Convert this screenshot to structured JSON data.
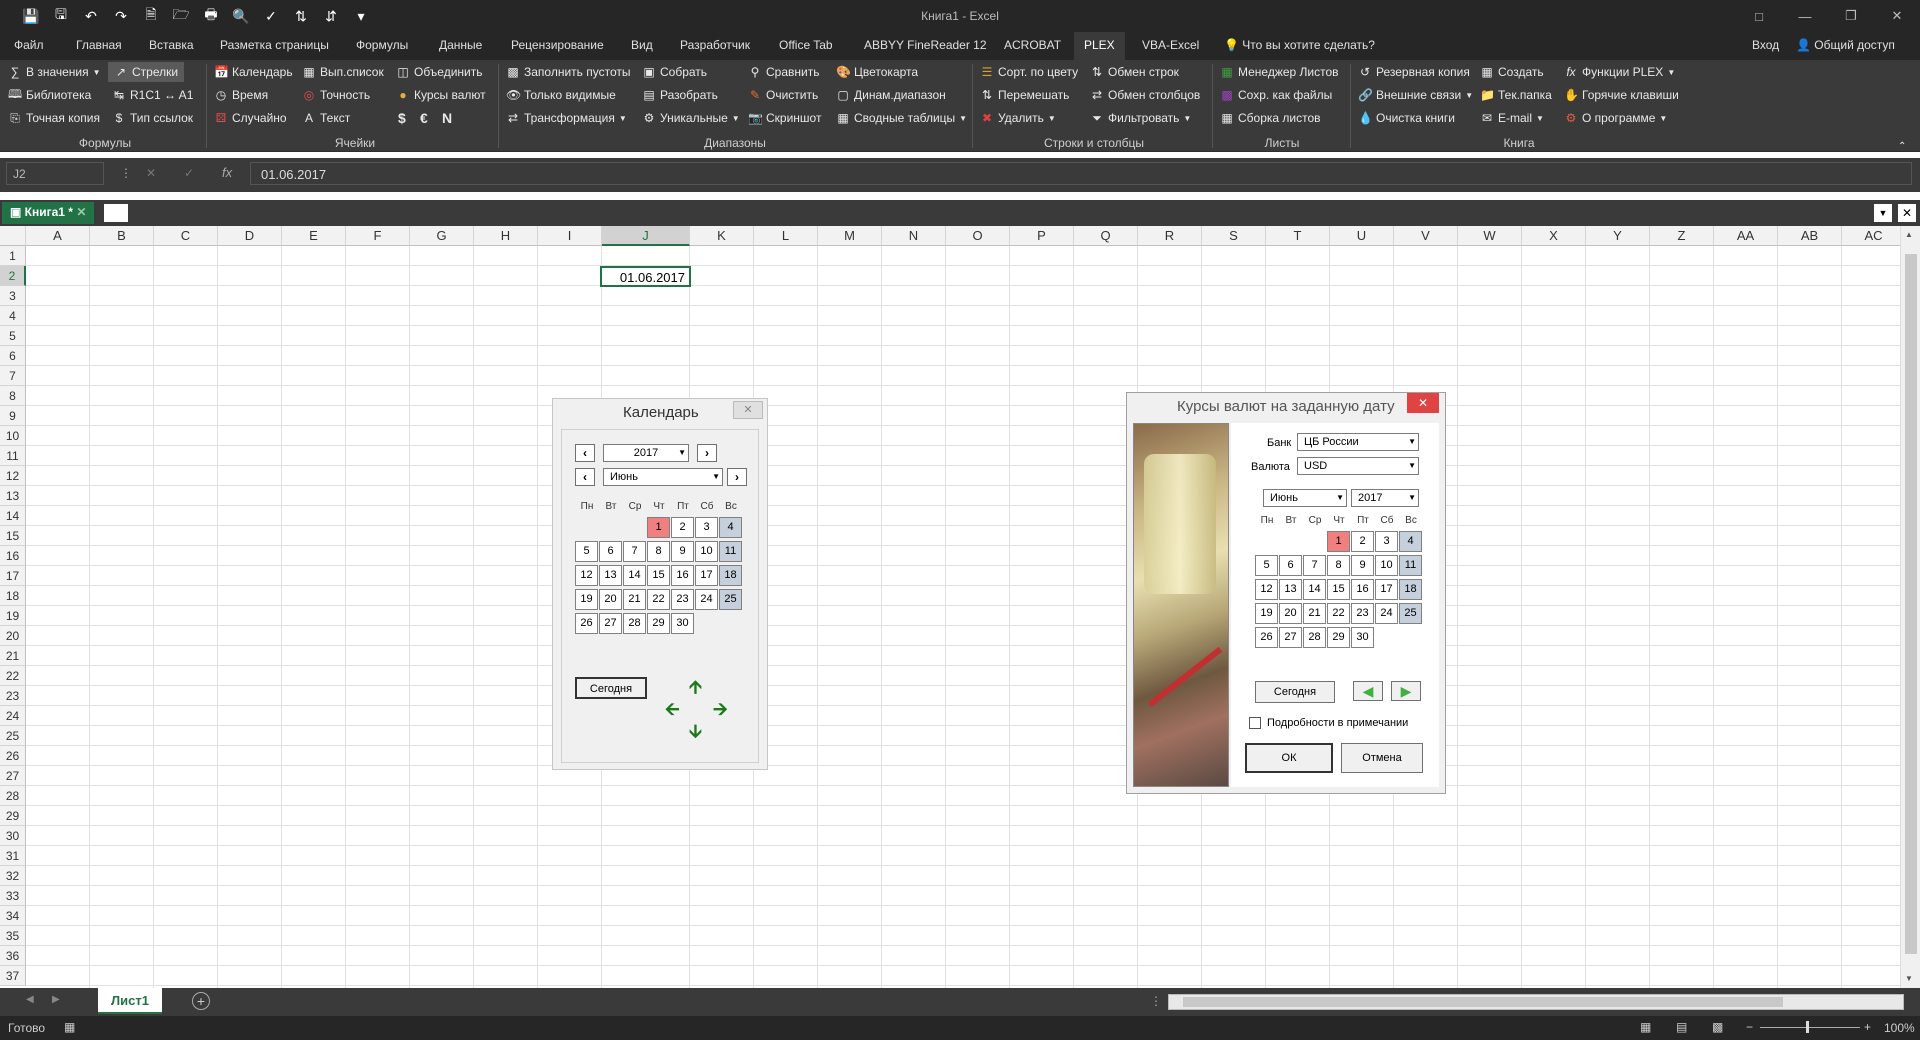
{
  "window": {
    "title": "Книга1 - Excel"
  },
  "ribbon_tabs": [
    "Файл",
    "Главная",
    "Вставка",
    "Разметка страницы",
    "Формулы",
    "Данные",
    "Рецензирование",
    "Вид",
    "Разработчик",
    "Office Tab",
    "ABBYY FineReader 12",
    "ACROBAT",
    "PLEX",
    "VBA-Excel",
    "Что вы хотите сделать?"
  ],
  "account": {
    "signin": "Вход",
    "share": "Общий доступ"
  },
  "ribbon": {
    "formulas": {
      "label": "Формулы",
      "items": [
        "В значения",
        "Библиотека",
        "Точная копия",
        "Стрелки",
        "R1C1 ↔ A1",
        "Тип ссылок"
      ]
    },
    "cells": {
      "label": "Ячейки",
      "items": [
        "Календарь",
        "Время",
        "Случайно",
        "Вып.список",
        "Точность",
        "Текст",
        "Объединить",
        "Курсы валют",
        "$",
        "€",
        "N"
      ]
    },
    "ranges": {
      "label": "Диапазоны",
      "items": [
        "Заполнить пустоты",
        "Только видимые",
        "Трансформация",
        "Собрать",
        "Разобрать",
        "Уникальные",
        "Сравнить",
        "Очистить",
        "Скриншот",
        "Цветокарта",
        "Динам.диапазон",
        "Сводные таблицы"
      ]
    },
    "rowscols": {
      "label": "Строки и столбцы",
      "items": [
        "Сорт. по цвету",
        "Перемешать",
        "Удалить",
        "Обмен строк",
        "Обмен столбцов",
        "Фильтровать"
      ]
    },
    "sheets": {
      "label": "Листы",
      "items": [
        "Менеджер Листов",
        "Сохр. как файлы",
        "Сборка листов"
      ]
    },
    "book": {
      "label": "Книга",
      "items": [
        "Резервная копия",
        "Внешние связи",
        "Очистка книги",
        "Создать",
        "Тек.папка",
        "E-mail",
        "Функции PLEX",
        "Горячие клавиши",
        "О программе"
      ]
    }
  },
  "formula_bar": {
    "name_box": "J2",
    "fx": "fx",
    "value": "01.06.2017"
  },
  "workbook_tab": "Книга1 *",
  "columns": [
    "A",
    "B",
    "C",
    "D",
    "E",
    "F",
    "G",
    "H",
    "I",
    "J",
    "K",
    "L",
    "M",
    "N",
    "O",
    "P",
    "Q",
    "R",
    "S",
    "T",
    "U",
    "V",
    "W",
    "X",
    "Y",
    "Z",
    "AA",
    "AB",
    "AC"
  ],
  "rows": [
    "1",
    "2",
    "3",
    "4",
    "5",
    "6",
    "7",
    "8",
    "9",
    "10",
    "11",
    "12",
    "13",
    "14",
    "15",
    "16",
    "17",
    "18",
    "19",
    "20",
    "21",
    "22",
    "23",
    "24",
    "25",
    "26",
    "27",
    "28",
    "29",
    "30",
    "31",
    "32",
    "33",
    "34",
    "35",
    "36",
    "37"
  ],
  "cell_J2": "01.06.2017",
  "sheet_tab": "Лист1",
  "status": {
    "ready": "Готово",
    "zoom": "100%"
  },
  "calendar": {
    "title": "Календарь",
    "year": "2017",
    "month": "Июнь",
    "day_names": [
      "Пн",
      "Вт",
      "Ср",
      "Чт",
      "Пт",
      "Сб",
      "Вс"
    ],
    "weeks": [
      [
        "",
        "",
        "",
        "1",
        "2",
        "3",
        "4"
      ],
      [
        "5",
        "6",
        "7",
        "8",
        "9",
        "10",
        "11"
      ],
      [
        "12",
        "13",
        "14",
        "15",
        "16",
        "17",
        "18"
      ],
      [
        "19",
        "20",
        "21",
        "22",
        "23",
        "24",
        "25"
      ],
      [
        "26",
        "27",
        "28",
        "29",
        "30",
        "",
        ""
      ]
    ],
    "today_label": "Сегодня"
  },
  "rates": {
    "title": "Курсы валют на заданную дату",
    "bank_label": "Банк",
    "bank_value": "ЦБ России",
    "currency_label": "Валюта",
    "currency_value": "USD",
    "month": "Июнь",
    "year": "2017",
    "today_label": "Сегодня",
    "details_label": "Подробности в примечании",
    "ok_label": "ОК",
    "cancel_label": "Отмена"
  },
  "colors": {
    "excel_green": "#217346",
    "dark_bg": "#262626",
    "ribbon_bg": "#3a3a3a",
    "today": "#f08080",
    "weekend": "#c5d0dc"
  }
}
